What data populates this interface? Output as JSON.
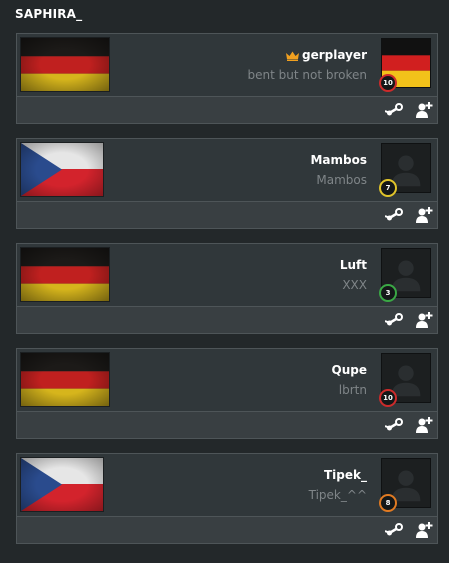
{
  "team": {
    "title": "SAPHIRA_"
  },
  "players": [
    {
      "name": "gerplayer",
      "status": "bent but not broken",
      "flag": "de",
      "level": "10",
      "level_color": "#cc2b2b",
      "avatar": "german-flag",
      "owner": true
    },
    {
      "name": "Mambos",
      "status": "Mambos",
      "flag": "cz",
      "level": "7",
      "level_color": "#e0c42a",
      "avatar": "default",
      "owner": false
    },
    {
      "name": "Luft",
      "status": "XXX",
      "flag": "de",
      "level": "3",
      "level_color": "#3aa845",
      "avatar": "default",
      "owner": false
    },
    {
      "name": "Qupe",
      "status": "lbrtn",
      "flag": "de",
      "level": "10",
      "level_color": "#cc2b2b",
      "avatar": "default",
      "owner": false
    },
    {
      "name": "Tipek_",
      "status": "Tipek_^^",
      "flag": "cz",
      "level": "8",
      "level_color": "#e07a22",
      "avatar": "default",
      "owner": false
    }
  ],
  "icons": {
    "owner": "crown-icon",
    "steam": "steam-icon",
    "add_friend": "add-friend-icon"
  },
  "colors": {
    "background": "#23282a",
    "card": "#30373a",
    "footer": "#393f42",
    "crown": "#f0a020",
    "muted_text": "#7f8588"
  }
}
